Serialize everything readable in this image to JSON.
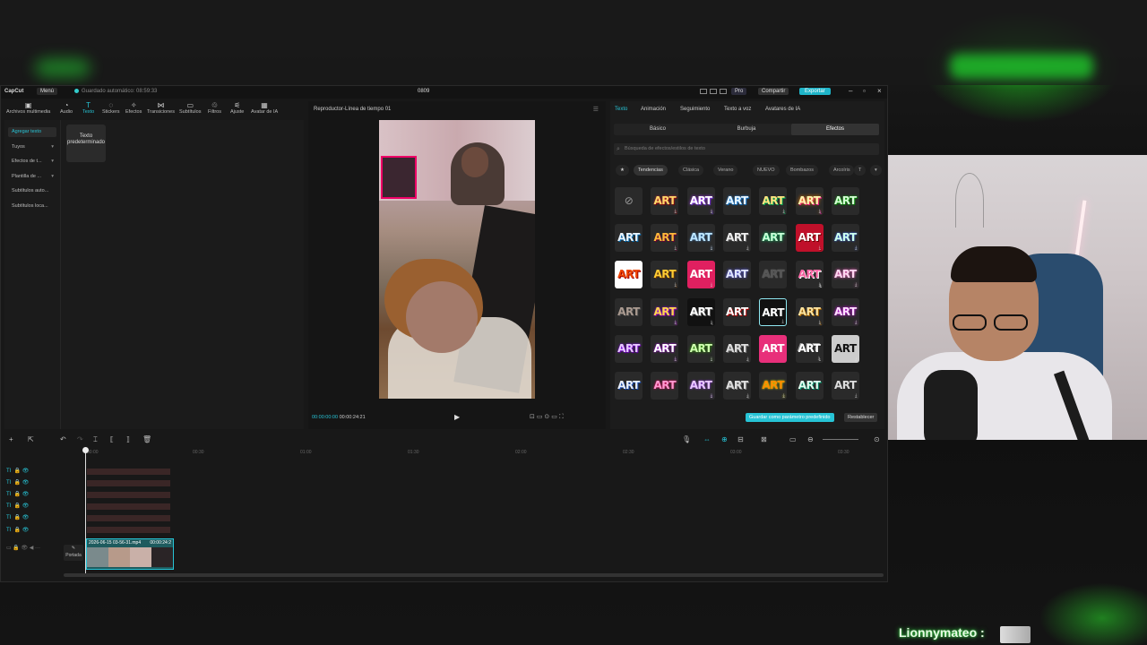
{
  "titlebar": {
    "app_name": "CapCut",
    "menu_label": "Menú",
    "autosave": "Guardado automático: 08:59:33",
    "project_name": "0809",
    "pro_label": "Pro",
    "share_label": "Compartir",
    "export_label": "Exportar",
    "minimize": "–",
    "maximize": "▫",
    "close": "×"
  },
  "toolbar": [
    {
      "label": "Archivos multimedia",
      "icon": "media-icon"
    },
    {
      "label": "Audio",
      "icon": "audio-icon"
    },
    {
      "label": "Texto",
      "icon": "text-icon"
    },
    {
      "label": "Stickers",
      "icon": "stickers-icon"
    },
    {
      "label": "Efectos",
      "icon": "effects-icon"
    },
    {
      "label": "Transiciones",
      "icon": "transitions-icon"
    },
    {
      "label": "Subtítulos",
      "icon": "subtitles-icon"
    },
    {
      "label": "Filtros",
      "icon": "filters-icon"
    },
    {
      "label": "Ajuste",
      "icon": "adjust-icon"
    },
    {
      "label": "Avatar de IA",
      "icon": "ai-avatar-icon"
    }
  ],
  "categories": [
    "Agregar texto",
    "Tuyos",
    "Efectos de t...",
    "Plantilla de ...",
    "Subtítulos auto...",
    "Subtítulos loca..."
  ],
  "default_text_card": "Texto predeterminado",
  "player": {
    "title": "Reproductor-Línea de tiempo 01",
    "current_time": "00:00:00:00",
    "total_time": "00:00:24:21"
  },
  "text_panel": {
    "tabs": [
      "Texto",
      "Animación",
      "Seguimiento",
      "Texto a voz",
      "Avatares de IA"
    ],
    "active_tab": "Texto",
    "subtabs": [
      "Básico",
      "Burbuja",
      "Efectos"
    ],
    "active_subtab": "Efectos",
    "search_placeholder": "Búsqueda de efectos/estilos de texto",
    "chips": [
      "Tendencias",
      "Clásica",
      "Verano",
      "NUEVO",
      "Bombazos",
      "Arcoíris"
    ],
    "art_label": "ART",
    "save_button": "Guardar como parámetro predefinido",
    "reset_button": "Restablecer"
  },
  "timeline": {
    "ruler": [
      "00:00",
      "00:30",
      "01:00",
      "01:30",
      "02:00",
      "02:30",
      "03:00",
      "03:30"
    ],
    "clip_name": "2026-06-15 03-56-31.mp4",
    "clip_duration": "00:00:24:2",
    "cover_label": "Portada"
  },
  "chat": {
    "username": "Lionnymateo :"
  },
  "colors": {
    "accent": "#27c4d6",
    "export_bg": "#1fb5c9",
    "chat_glow": "#3bd34a"
  }
}
